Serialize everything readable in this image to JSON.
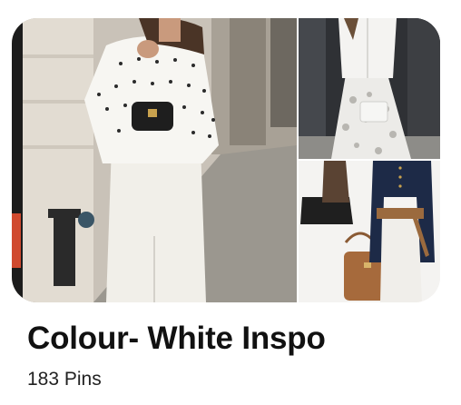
{
  "board": {
    "title": "Colour- White Inspo",
    "pin_count_label": "183 Pins"
  },
  "collage": {
    "cover_image": "woman-polka-dot-blouse-white-pencil-skirt-photo",
    "top_right_image": "white-leather-jacket-lace-skirt-photo",
    "bottom_right_image": "navy-blouse-white-skirt-tan-belt-handbag-photo"
  }
}
